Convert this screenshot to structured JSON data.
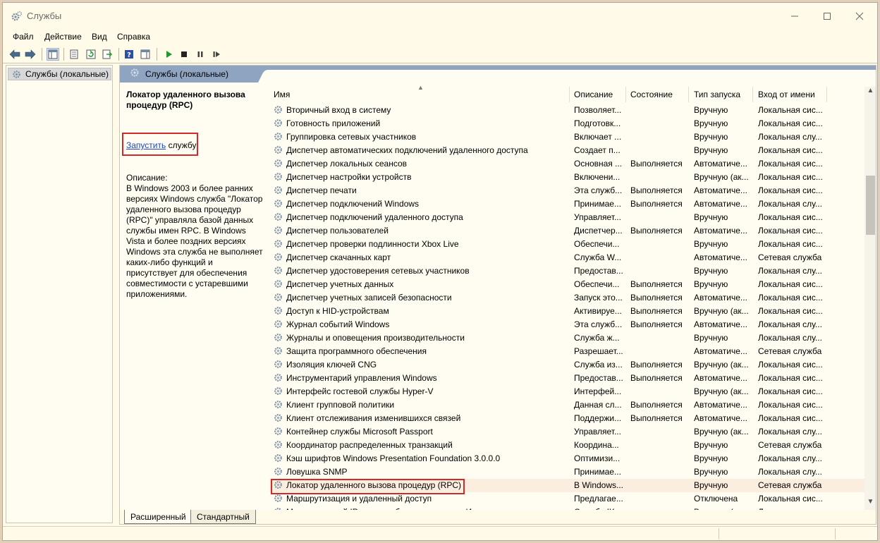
{
  "window": {
    "title": "Службы"
  },
  "menu": {
    "file": "Файл",
    "action": "Действие",
    "view": "Вид",
    "help": "Справка"
  },
  "tree": {
    "root_label": "Службы (локальные)"
  },
  "pane": {
    "header_title": "Службы (локальные)",
    "selected_title": "Локатор удаленного вызова процедур (RPC)",
    "start_link": "Запустить",
    "start_suffix": " службу",
    "description_label": "Описание:",
    "description_text": "В Windows 2003 и более ранних версиях Windows служба \"Локатор удаленного вызова процедур (RPC)\" управляла базой данных службы имен RPC. В Windows Vista и более поздних версиях Windows эта служба не выполняет каких-либо функций и присутствует для обеспечения совместимости с устаревшими приложениями."
  },
  "columns": {
    "name": "Имя",
    "description": "Описание",
    "state": "Состояние",
    "startup": "Тип запуска",
    "logon": "Вход от имени"
  },
  "services": [
    {
      "name": "Вторичный вход в систему",
      "desc": "Позволяет...",
      "state": "",
      "startup": "Вручную",
      "logon": "Локальная сис..."
    },
    {
      "name": "Готовность приложений",
      "desc": "Подготовк...",
      "state": "",
      "startup": "Вручную",
      "logon": "Локальная сис..."
    },
    {
      "name": "Группировка сетевых участников",
      "desc": "Включает ...",
      "state": "",
      "startup": "Вручную",
      "logon": "Локальная слу..."
    },
    {
      "name": "Диспетчер автоматических подключений удаленного доступа",
      "desc": "Создает п...",
      "state": "",
      "startup": "Вручную",
      "logon": "Локальная сис..."
    },
    {
      "name": "Диспетчер локальных сеансов",
      "desc": "Основная ...",
      "state": "Выполняется",
      "startup": "Автоматиче...",
      "logon": "Локальная сис..."
    },
    {
      "name": "Диспетчер настройки устройств",
      "desc": "Включени...",
      "state": "",
      "startup": "Вручную (ак...",
      "logon": "Локальная сис..."
    },
    {
      "name": "Диспетчер печати",
      "desc": "Эта служб...",
      "state": "Выполняется",
      "startup": "Автоматиче...",
      "logon": "Локальная сис..."
    },
    {
      "name": "Диспетчер подключений Windows",
      "desc": "Принимае...",
      "state": "Выполняется",
      "startup": "Автоматиче...",
      "logon": "Локальная слу..."
    },
    {
      "name": "Диспетчер подключений удаленного доступа",
      "desc": "Управляет...",
      "state": "",
      "startup": "Вручную",
      "logon": "Локальная сис..."
    },
    {
      "name": "Диспетчер пользователей",
      "desc": "Диспетчер...",
      "state": "Выполняется",
      "startup": "Автоматиче...",
      "logon": "Локальная сис..."
    },
    {
      "name": "Диспетчер проверки подлинности Xbox Live",
      "desc": "Обеспечи...",
      "state": "",
      "startup": "Вручную",
      "logon": "Локальная сис..."
    },
    {
      "name": "Диспетчер скачанных карт",
      "desc": "Служба W...",
      "state": "",
      "startup": "Автоматиче...",
      "logon": "Сетевая служба"
    },
    {
      "name": "Диспетчер удостоверения сетевых участников",
      "desc": "Предостав...",
      "state": "",
      "startup": "Вручную",
      "logon": "Локальная слу..."
    },
    {
      "name": "Диспетчер учетных данных",
      "desc": "Обеспечи...",
      "state": "Выполняется",
      "startup": "Вручную",
      "logon": "Локальная сис..."
    },
    {
      "name": "Диспетчер учетных записей безопасности",
      "desc": "Запуск это...",
      "state": "Выполняется",
      "startup": "Автоматиче...",
      "logon": "Локальная сис..."
    },
    {
      "name": "Доступ к HID-устройствам",
      "desc": "Активируе...",
      "state": "Выполняется",
      "startup": "Вручную (ак...",
      "logon": "Локальная сис..."
    },
    {
      "name": "Журнал событий Windows",
      "desc": "Эта служб...",
      "state": "Выполняется",
      "startup": "Автоматиче...",
      "logon": "Локальная слу..."
    },
    {
      "name": "Журналы и оповещения производительности",
      "desc": "Служба ж...",
      "state": "",
      "startup": "Вручную",
      "logon": "Локальная слу..."
    },
    {
      "name": "Защита программного обеспечения",
      "desc": "Разрешает...",
      "state": "",
      "startup": "Автоматиче...",
      "logon": "Сетевая служба"
    },
    {
      "name": "Изоляция ключей CNG",
      "desc": "Служба из...",
      "state": "Выполняется",
      "startup": "Вручную (ак...",
      "logon": "Локальная сис..."
    },
    {
      "name": "Инструментарий управления Windows",
      "desc": "Предостав...",
      "state": "Выполняется",
      "startup": "Автоматиче...",
      "logon": "Локальная сис..."
    },
    {
      "name": "Интерфейс гостевой службы Hyper-V",
      "desc": "Интерфей...",
      "state": "",
      "startup": "Вручную (ак...",
      "logon": "Локальная сис..."
    },
    {
      "name": "Клиент групповой политики",
      "desc": "Данная сл...",
      "state": "Выполняется",
      "startup": "Автоматиче...",
      "logon": "Локальная сис..."
    },
    {
      "name": "Клиент отслеживания изменившихся связей",
      "desc": "Поддержи...",
      "state": "Выполняется",
      "startup": "Автоматиче...",
      "logon": "Локальная сис..."
    },
    {
      "name": "Контейнер службы Microsoft Passport",
      "desc": "Управляет...",
      "state": "",
      "startup": "Вручную (ак...",
      "logon": "Локальная слу..."
    },
    {
      "name": "Координатор распределенных транзакций",
      "desc": "Координа...",
      "state": "",
      "startup": "Вручную",
      "logon": "Сетевая служба"
    },
    {
      "name": "Кэш шрифтов Windows Presentation Foundation 3.0.0.0",
      "desc": "Оптимизи...",
      "state": "",
      "startup": "Вручную",
      "logon": "Локальная слу..."
    },
    {
      "name": "Ловушка SNMP",
      "desc": "Принимае...",
      "state": "",
      "startup": "Вручную",
      "logon": "Локальная слу..."
    },
    {
      "name": "Локатор удаленного вызова процедур (RPC)",
      "desc": "В Windows...",
      "state": "",
      "startup": "Вручную",
      "logon": "Сетевая служба",
      "selected": true
    },
    {
      "name": "Маршрутизация и удаленный доступ",
      "desc": "Предлагае...",
      "state": "",
      "startup": "Отключена",
      "logon": "Локальная сис..."
    },
    {
      "name": "Модули ключей IPsec для обмена ключами в Интернете и протокола...",
      "desc": "Служба IK...",
      "state": "",
      "startup": "Вручную (ак...",
      "logon": "Локальная сис..."
    }
  ],
  "tabs": {
    "extended": "Расширенный",
    "standard": "Стандартный"
  },
  "icons": {
    "app": "services-gear-icon",
    "back": "back-arrow-icon",
    "forward": "forward-arrow-icon",
    "play": "play-icon",
    "stop": "stop-icon",
    "pause": "pause-icon",
    "resume": "resume-icon"
  },
  "colors": {
    "accent_red": "#d12a2a",
    "link": "#1f47b9",
    "header_blue": "#8ea4c0",
    "play_green": "#1f9a2b"
  }
}
